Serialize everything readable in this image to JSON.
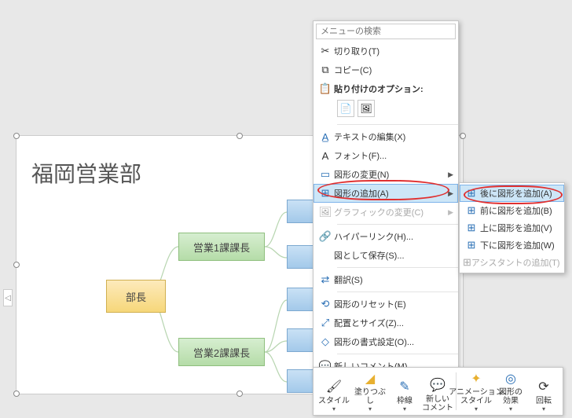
{
  "title": "福岡営業部",
  "org": {
    "root": "部長",
    "node1": "営業1課課長",
    "node2": "営業2課課長"
  },
  "menu": {
    "search_placeholder": "メニューの検索",
    "cut": "切り取り(T)",
    "copy": "コピー(C)",
    "paste_header": "貼り付けのオプション:",
    "edit_text": "テキストの編集(X)",
    "font": "フォント(F)...",
    "change_shape": "図形の変更(N)",
    "add_shape": "図形の追加(A)",
    "change_graphic": "グラフィックの変更(C)",
    "hyperlink": "ハイパーリンク(H)...",
    "save_as_picture": "図として保存(S)...",
    "translate": "翻訳(S)",
    "reset_shape": "図形のリセット(E)",
    "size_position": "配置とサイズ(Z)...",
    "format_shape": "図形の書式設定(O)...",
    "new_comment": "新しいコメント(M)"
  },
  "submenu": {
    "add_after": "後に図形を追加(A)",
    "add_before": "前に図形を追加(B)",
    "add_above": "上に図形を追加(V)",
    "add_below": "下に図形を追加(W)",
    "add_assistant": "アシスタントの追加(T)"
  },
  "minibar": {
    "style": "スタイル",
    "fill": "塗りつぶし",
    "outline": "枠線",
    "comment": "新しい\nコメント",
    "anim_style": "アニメーション\nスタイル",
    "effects": "図形の\n効果",
    "rotate": "回転"
  }
}
